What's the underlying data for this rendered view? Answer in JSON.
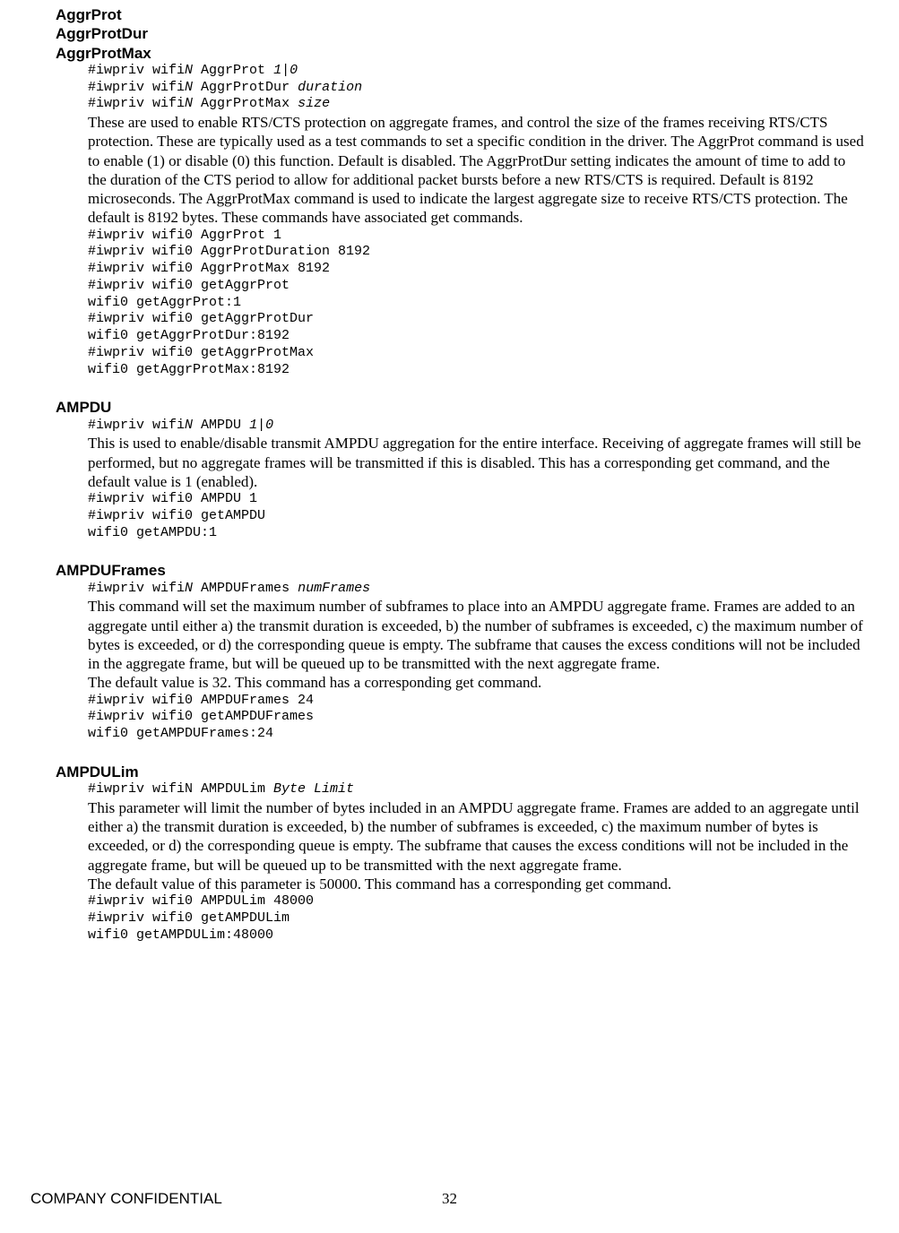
{
  "sections": [
    {
      "titles": [
        "AggrProt",
        "AggrProtDur",
        "AggrProtMax"
      ],
      "syntax": [
        {
          "pre": "#iwpriv wifi",
          "it": "N",
          "mid": " AggrProt ",
          "arg": "1|0"
        },
        {
          "pre": "#iwpriv wifi",
          "it": "N",
          "mid": " AggrProtDur ",
          "arg": "duration"
        },
        {
          "pre": "#iwpriv wifi",
          "it": "N",
          "mid": " AggrProtMax ",
          "arg": "size"
        }
      ],
      "paras": [
        "These are used to enable RTS/CTS protection on aggregate frames, and control the size of the frames receiving RTS/CTS protection. These are typically used as a test commands to set a specific condition in the driver. The AggrProt command is used to enable (1) or disable (0) this function. Default is disabled. The AggrProtDur setting indicates the amount of time to add to the duration of the CTS period to allow for additional packet bursts before a new RTS/CTS is required. Default is 8192 microseconds. The AggrProtMax command is used to indicate the largest aggregate size to receive RTS/CTS protection. The default is 8192 bytes. These commands have associated get commands."
      ],
      "example": "#iwpriv wifi0 AggrProt 1\n#iwpriv wifi0 AggrProtDuration 8192\n#iwpriv wifi0 AggrProtMax 8192\n#iwpriv wifi0 getAggrProt\nwifi0 getAggrProt:1\n#iwpriv wifi0 getAggrProtDur\nwifi0 getAggrProtDur:8192\n#iwpriv wifi0 getAggrProtMax\nwifi0 getAggrProtMax:8192"
    },
    {
      "titles": [
        "AMPDU"
      ],
      "syntax": [
        {
          "pre": "#iwpriv wifi",
          "it": "N",
          "mid": " AMPDU ",
          "arg": "1|0"
        }
      ],
      "paras": [
        "This is used to enable/disable transmit AMPDU aggregation for the entire interface. Receiving of aggregate frames will still be performed, but no aggregate frames will be transmitted if this is disabled. This has a corresponding get command, and the default value is 1 (enabled)."
      ],
      "example": "#iwpriv wifi0 AMPDU 1\n#iwpriv wifi0 getAMPDU\nwifi0 getAMPDU:1"
    },
    {
      "titles": [
        "AMPDUFrames"
      ],
      "syntax": [
        {
          "pre": "#iwpriv wifi",
          "it": "N",
          "mid": " AMPDUFrames ",
          "arg": "numFrames"
        }
      ],
      "paras": [
        "This command will set the maximum number of subframes to place into an AMPDU aggregate frame. Frames are added to an aggregate until either a) the transmit duration is exceeded, b) the number of subframes is exceeded, c) the maximum number of bytes is exceeded, or d) the corresponding queue is empty. The subframe that causes the excess conditions will not be included in the aggregate frame, but will be queued up to be transmitted with the next aggregate frame.",
        "The default value is 32. This command has a corresponding get command."
      ],
      "example": "#iwpriv wifi0 AMPDUFrames 24\n#iwpriv wifi0 getAMPDUFrames\nwifi0 getAMPDUFrames:24"
    },
    {
      "titles": [
        "AMPDULim"
      ],
      "syntax": [
        {
          "pre": "#iwpriv wifiN AMPDULim ",
          "it": "",
          "mid": "",
          "arg": "Byte Limit"
        }
      ],
      "paras": [
        "This parameter will limit the number of bytes included in an AMPDU aggregate frame. Frames are added to an aggregate until either a) the transmit duration is exceeded, b) the number of subframes is exceeded, c) the maximum number of bytes is exceeded, or d) the corresponding queue is empty. The subframe that causes the excess conditions will not be included in the aggregate frame, but will be queued up to be transmitted with the next aggregate frame.",
        "The default value of this parameter is 50000. This command has a corresponding get command."
      ],
      "example": "#iwpriv wifi0 AMPDULim 48000\n#iwpriv wifi0 getAMPDULim\nwifi0 getAMPDULim:48000"
    }
  ],
  "footer": {
    "left": "COMPANY CONFIDENTIAL",
    "page": "32"
  }
}
